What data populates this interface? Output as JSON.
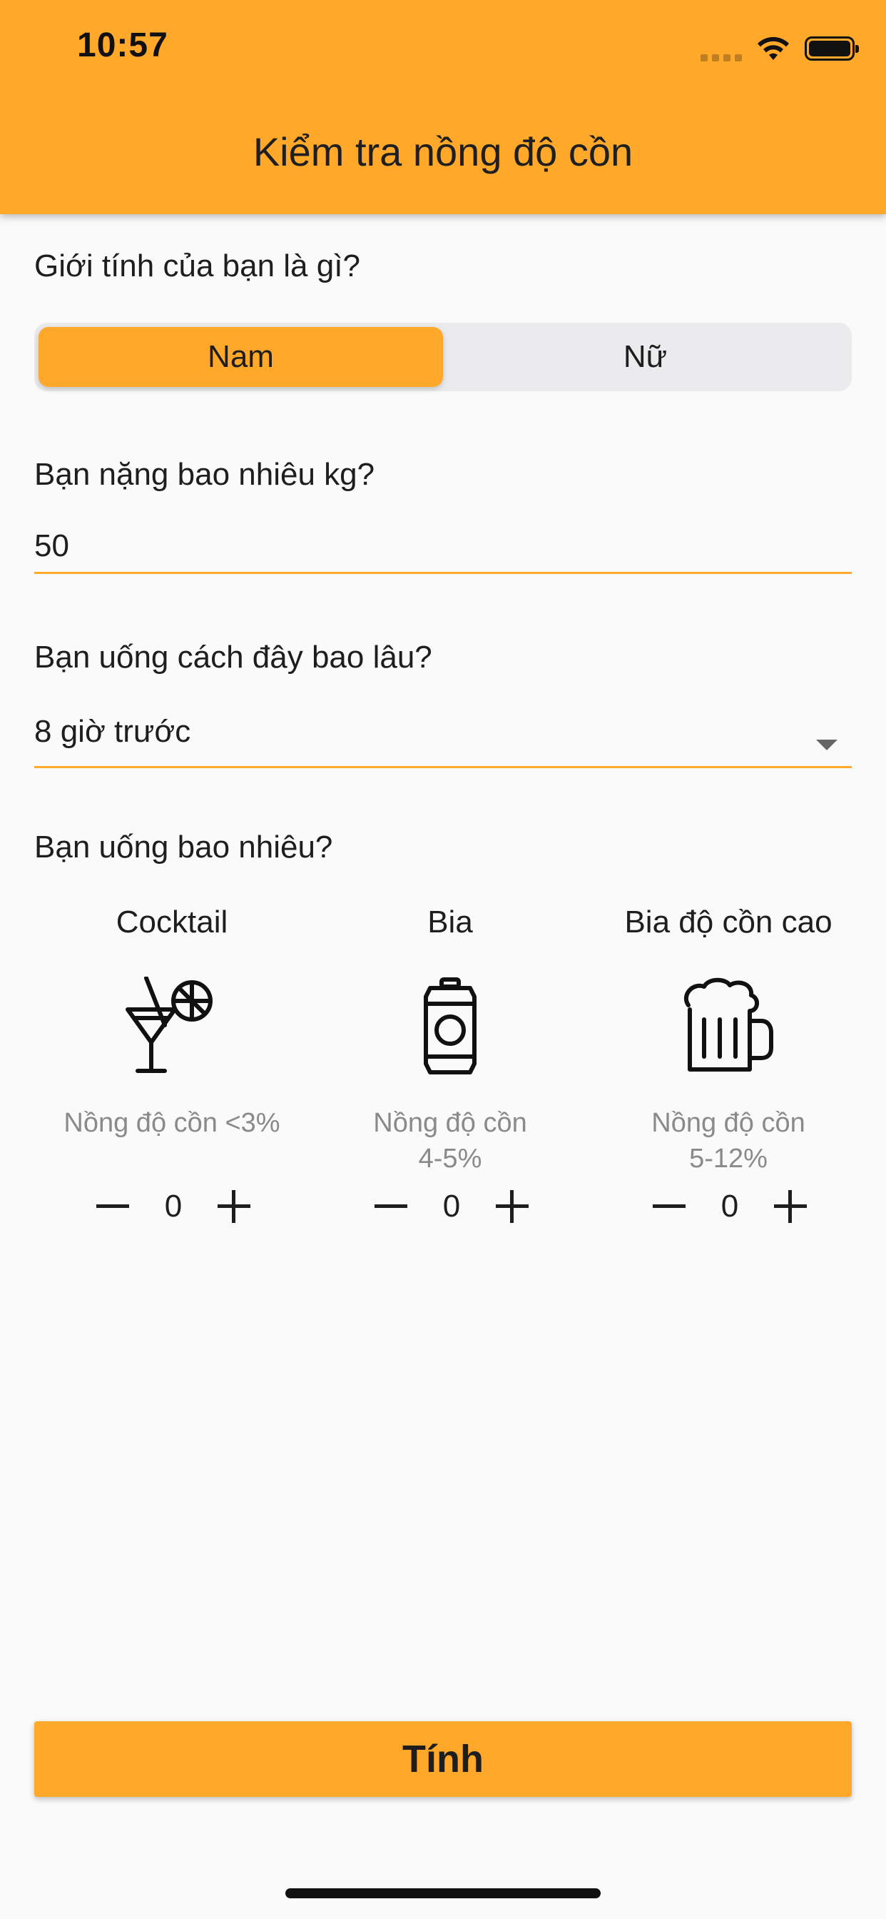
{
  "status_bar": {
    "time": "10:57"
  },
  "app_bar": {
    "title": "Kiểm tra nồng độ cồn",
    "color": "#ffa82a"
  },
  "gender": {
    "question": "Giới tính của bạn là gì?",
    "options": [
      "Nam",
      "Nữ"
    ],
    "selected": "Nam"
  },
  "weight": {
    "question": "Bạn nặng bao nhiêu kg?",
    "value": "50"
  },
  "time_since": {
    "question": "Bạn uống cách đây bao lâu?",
    "selected": "8 giờ trước"
  },
  "drinks": {
    "question": "Bạn uống bao nhiêu?",
    "items": [
      {
        "name": "Cocktail",
        "icon": "cocktail-icon",
        "desc_line1": "Nồng độ cồn <3%",
        "desc_line2": "",
        "count": "0"
      },
      {
        "name": "Bia",
        "icon": "beer-can-icon",
        "desc_line1": "Nồng độ cồn",
        "desc_line2": "4-5%",
        "count": "0"
      },
      {
        "name": "Bia độ cồn cao",
        "icon": "beer-mug-icon",
        "desc_line1": "Nồng độ cồn",
        "desc_line2": "5-12%",
        "count": "0"
      }
    ]
  },
  "submit": {
    "label": "Tính"
  }
}
